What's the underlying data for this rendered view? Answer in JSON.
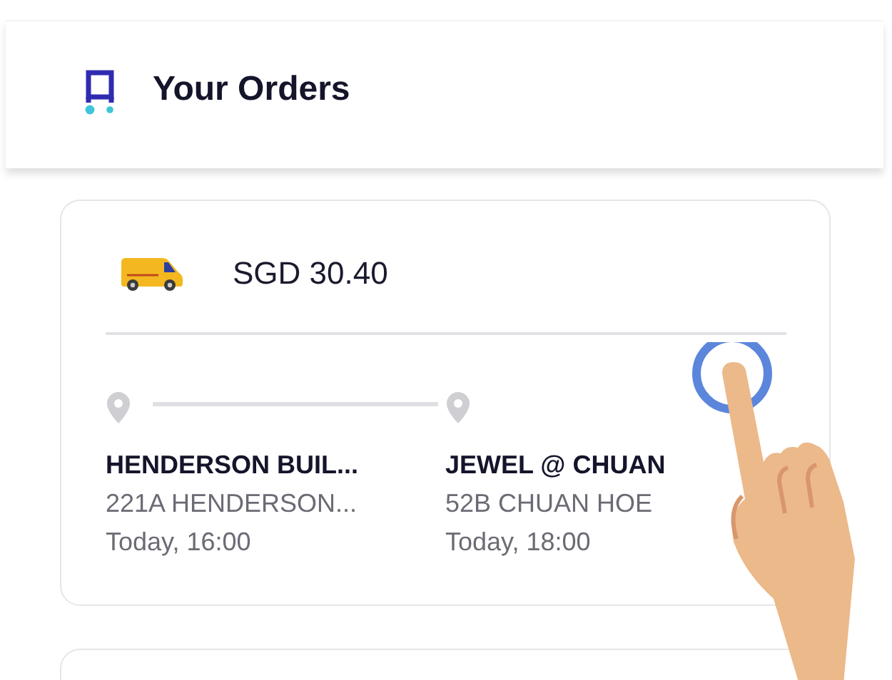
{
  "header": {
    "title": "Your Orders"
  },
  "orders": [
    {
      "price": "SGD 30.40",
      "stops": [
        {
          "name": "HENDERSON BUIL...",
          "address": "221A HENDERSON...",
          "time": "Today, 16:00"
        },
        {
          "name": "JEWEL @ CHUAN",
          "address": "52B CHUAN HOE",
          "time": "Today, 18:00"
        }
      ]
    }
  ]
}
